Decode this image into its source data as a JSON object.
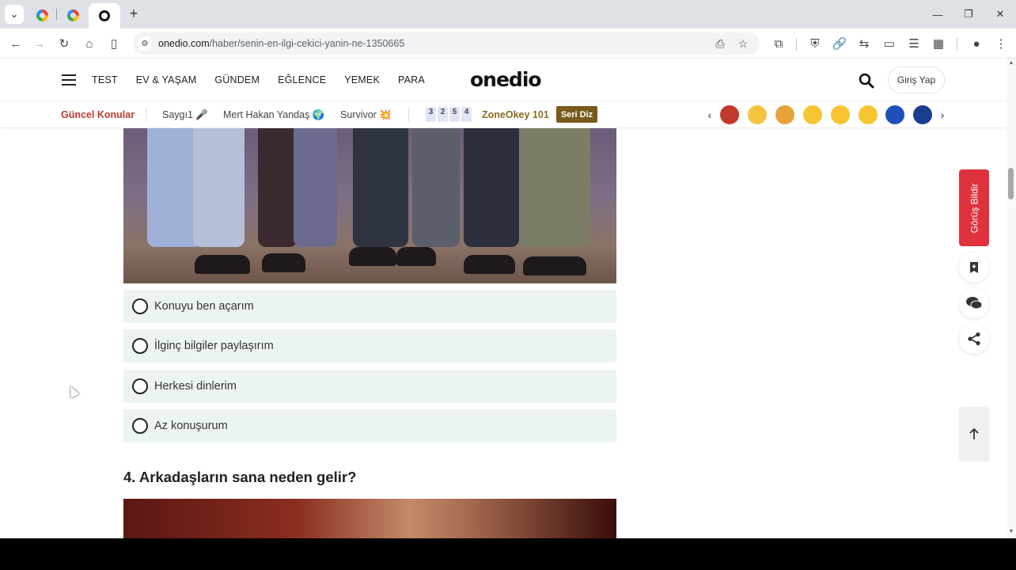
{
  "browser": {
    "url_domain": "onedio.com",
    "url_path": "/haber/senin-en-ilgi-cekici-yanin-ne-1350665"
  },
  "header": {
    "nav": [
      "TEST",
      "EV & YAŞAM",
      "GÜNDEM",
      "EĞLENCE",
      "YEMEK",
      "PARA"
    ],
    "logo": "onedio",
    "login": "Giriş Yap"
  },
  "topics": {
    "title": "Güncel Konular",
    "items": [
      "Saygı1 🎤",
      "Mert Hakan Yandaş 🌍",
      "Survivor 💥"
    ],
    "zone_digits": [
      "3",
      "2",
      "5",
      "4"
    ],
    "zone_name": "ZoneOkey 101",
    "seri": "Seri Diz"
  },
  "quiz": {
    "options": [
      "Konuyu ben açarım",
      "İlginç bilgiler paylaşırım",
      "Herkesi dinlerim",
      "Az konuşurum"
    ],
    "next_question": "4. Arkadaşların sana neden gelir?"
  },
  "side": {
    "feedback": "Görüş Bildir"
  },
  "colors": {
    "accent": "#e0323d",
    "option_bg": "#ecf4f1",
    "topic_title": "#c0392b",
    "zone": "#8a6d1f"
  }
}
